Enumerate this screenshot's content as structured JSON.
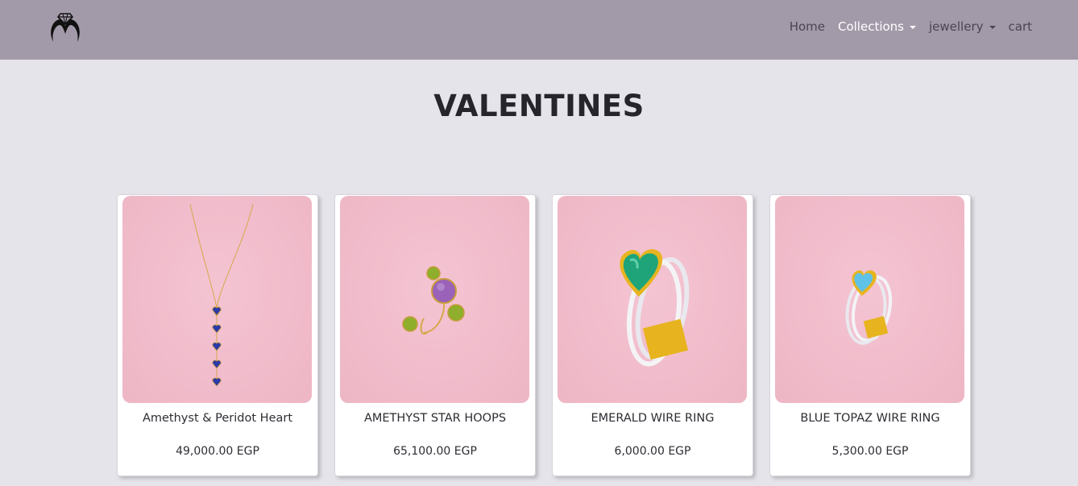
{
  "nav": {
    "logo_icon": "ring-diamond-logo-icon",
    "links": [
      {
        "label": "Home",
        "dropdown": false,
        "active": false
      },
      {
        "label": "Collections",
        "dropdown": true,
        "active": true
      },
      {
        "label": "jewellery",
        "dropdown": true,
        "active": false
      },
      {
        "label": "cart",
        "dropdown": false,
        "active": false
      }
    ]
  },
  "page": {
    "title": "VALENTINES"
  },
  "products": [
    {
      "name": "Amethyst & Peridot Heart",
      "price": "49,000.00 EGP",
      "image": "heart-drop-necklace-image"
    },
    {
      "name": "AMETHYST STAR HOOPS",
      "price": "65,100.00 EGP",
      "image": "amethyst-peridot-earring-image"
    },
    {
      "name": "EMERALD WIRE RING",
      "price": "6,000.00 EGP",
      "image": "emerald-heart-ring-image"
    },
    {
      "name": "BLUE TOPAZ WIRE RING",
      "price": "5,300.00 EGP",
      "image": "blue-topaz-heart-ring-image"
    }
  ],
  "colors": {
    "navbar": "#a39aa9",
    "background": "#e5e4ea",
    "card_image_bg": "#f1bccb",
    "active_link": "#ffffff"
  }
}
